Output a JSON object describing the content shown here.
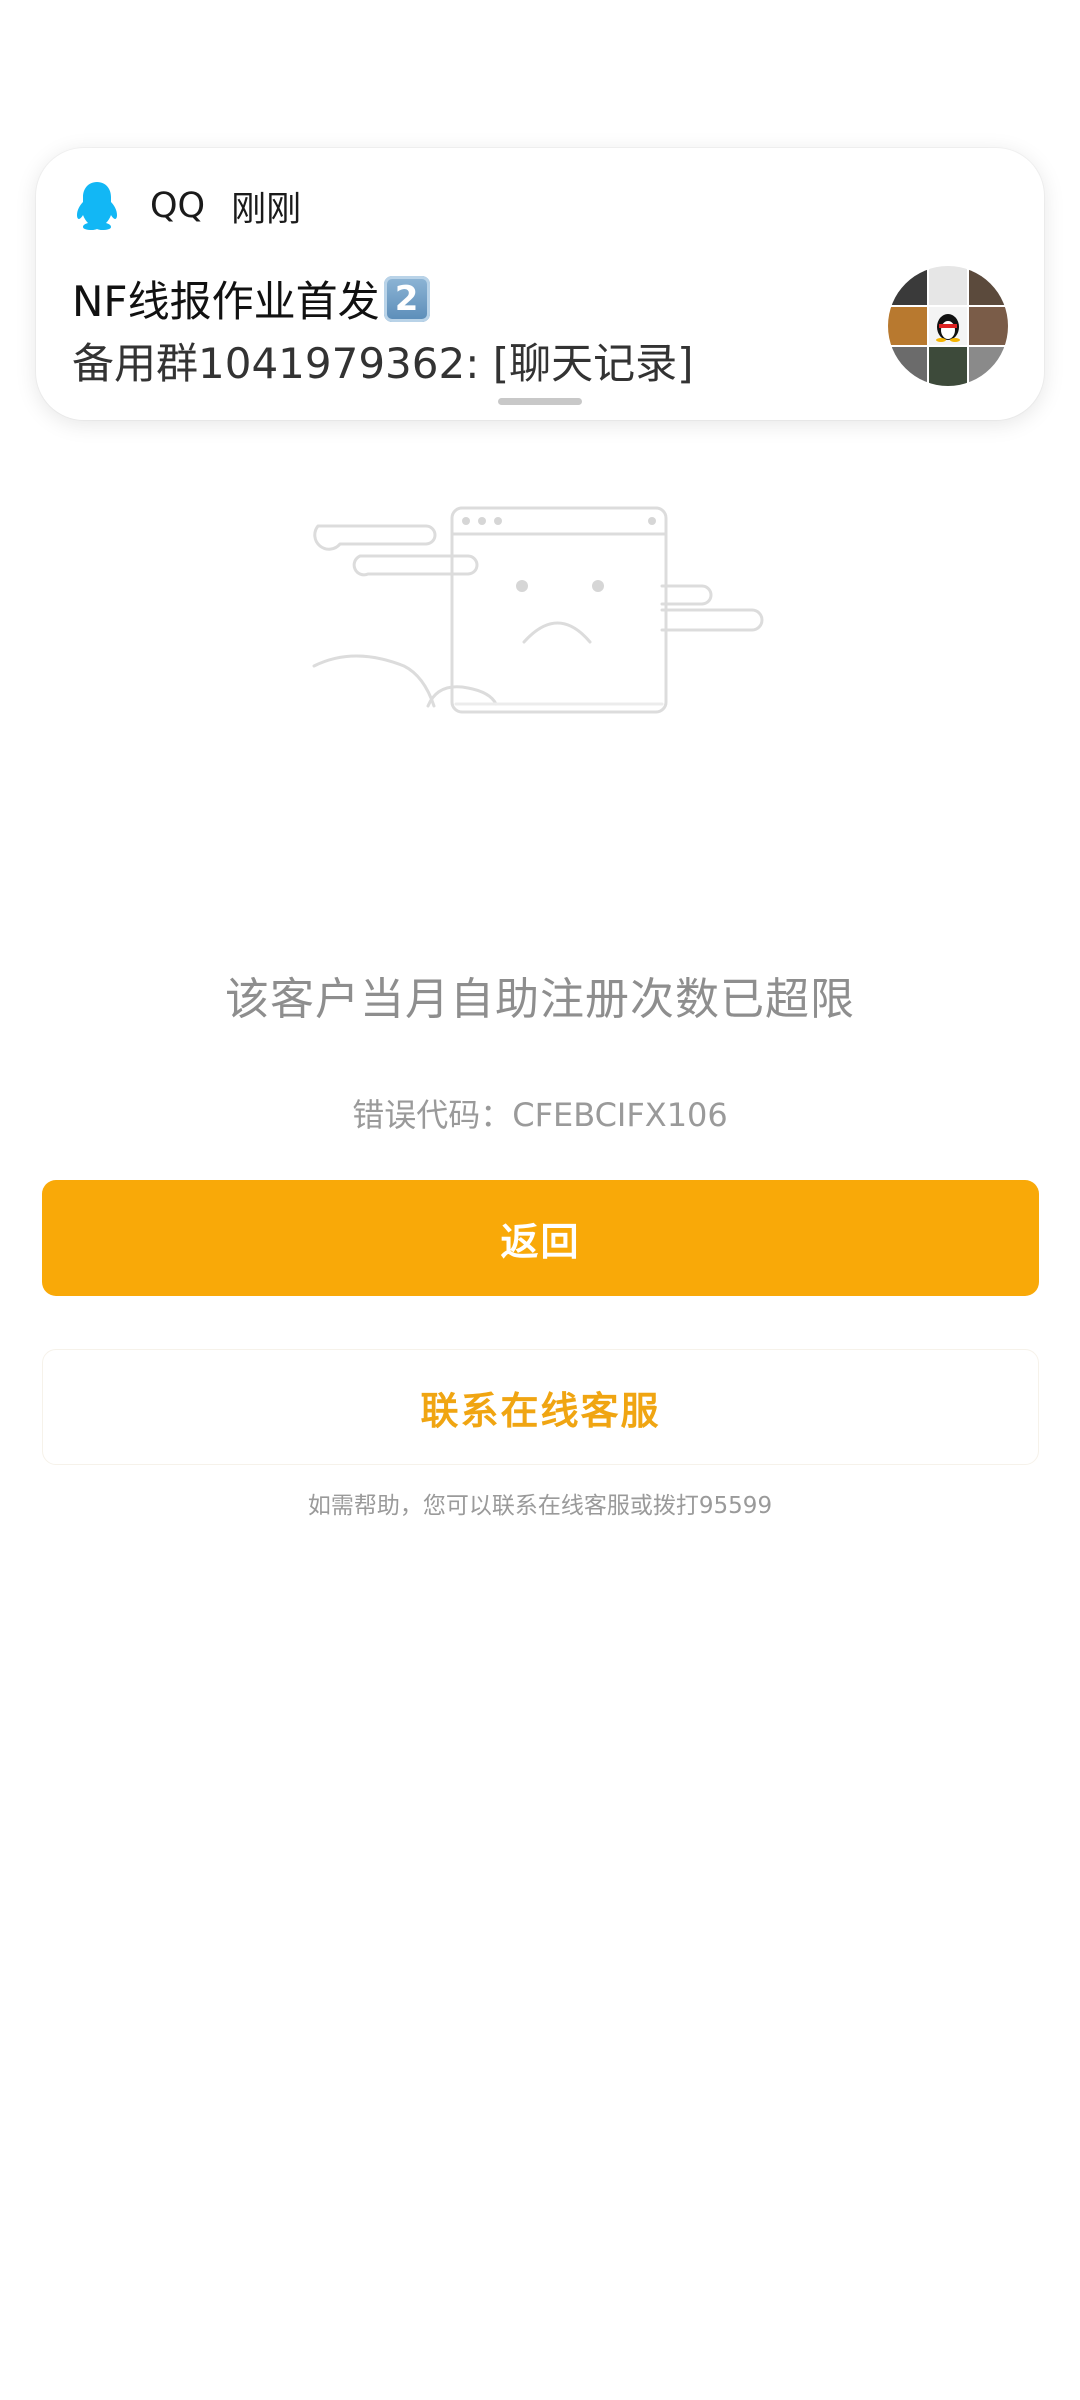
{
  "notification": {
    "app_name": "QQ",
    "time": "刚刚",
    "title": "NF线报作业首发",
    "title_badge": "2",
    "body": "备用群1041979362: [聊天记录]",
    "app_icon": "qq-penguin-icon",
    "avatar": "group-avatar-grid",
    "avatar_colors": [
      "#3a3a3a",
      "#e9e9e9",
      "#5b4a3c",
      "#b8792f",
      "#f2f2f2",
      "#7a5c48",
      "#6b6b6b",
      "#3d4a3a",
      "#8a8a8a"
    ]
  },
  "illustration": {
    "icon": "sad-browser-window-icon"
  },
  "error": {
    "message": "该客户当月自助注册次数已超限",
    "code_line": "错误代码：CFEBCIFX106"
  },
  "actions": {
    "back_label": "返回",
    "contact_label": "联系在线客服"
  },
  "help": {
    "text": "如需帮助，您可以联系在线客服或拨打95599"
  },
  "colors": {
    "primary": "#f9a908",
    "primary_text_on_white": "#f0a512",
    "qq_blue": "#12b7f5",
    "muted_text": "#8e8e8e"
  }
}
